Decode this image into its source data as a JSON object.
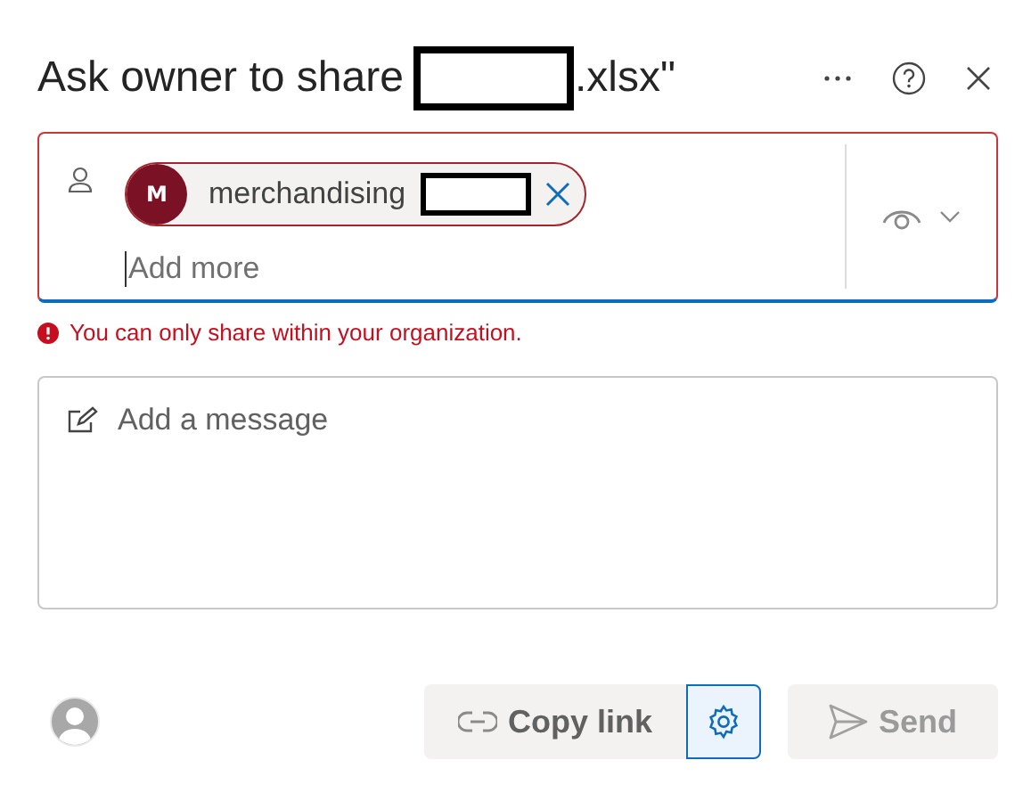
{
  "dialog": {
    "title_start": "Ask owner to share",
    "title_end": ".xlsx\"",
    "title_redacted": true
  },
  "recipients": {
    "chips": [
      {
        "initial": "M",
        "name": "merchandising",
        "redacted": true,
        "color": "#7a1124"
      }
    ],
    "placeholder": "Add more",
    "invalid": true
  },
  "error": "You can only share within your organization.",
  "message": {
    "placeholder": "Add a message"
  },
  "buttons": [
    {
      "kind": "copy",
      "label": "Copy link",
      "disabled": false
    },
    {
      "kind": "settings",
      "focused": true
    },
    {
      "kind": "send",
      "label": "Send",
      "disabled": true
    }
  ]
}
